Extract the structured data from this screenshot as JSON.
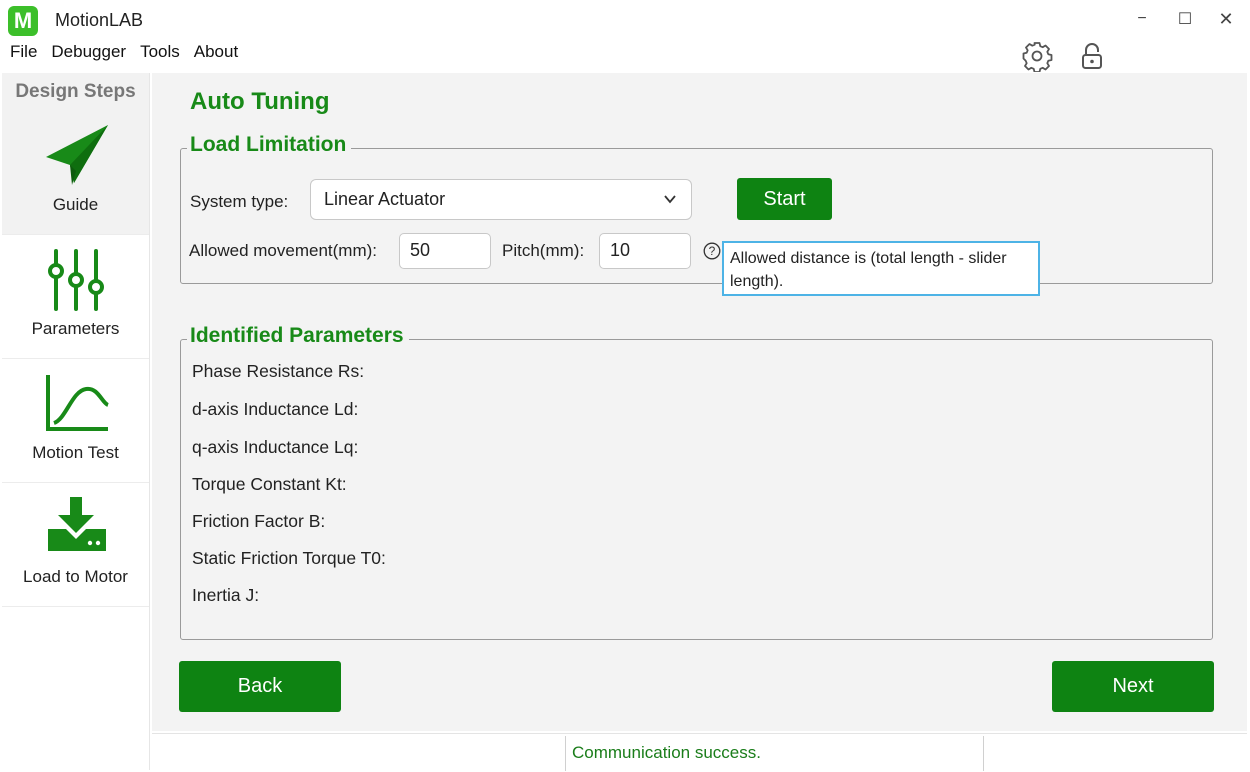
{
  "app": {
    "logo_letter": "M",
    "title": "MotionLAB",
    "logo_color": "#3cbf2a"
  },
  "window_controls": {
    "minimize": "−",
    "maximize": "☐",
    "close": "✕"
  },
  "menu": [
    "File",
    "Debugger",
    "Tools",
    "About"
  ],
  "toolbar_icons": [
    "settings-icon",
    "lock-icon"
  ],
  "sidebar": {
    "header": "Design Steps",
    "steps": [
      {
        "label": "Guide",
        "icon": "paper-plane-icon",
        "active": true
      },
      {
        "label": "Parameters",
        "icon": "sliders-icon",
        "active": false
      },
      {
        "label": "Motion Test",
        "icon": "curve-chart-icon",
        "active": false
      },
      {
        "label": "Load to Motor",
        "icon": "download-to-drive-icon",
        "active": false
      }
    ]
  },
  "main": {
    "title": "Auto Tuning",
    "load_limitation": {
      "title": "Load Limitation",
      "system_type_label": "System type:",
      "system_type_value": "Linear Actuator",
      "start_button": "Start",
      "allowed_movement_label": "Allowed movement(mm):",
      "allowed_movement_value": "50",
      "pitch_label": "Pitch(mm):",
      "pitch_value": "10",
      "help_icon": "?",
      "tooltip": "Allowed distance is (total length - slider length)."
    },
    "identified_parameters": {
      "title": "Identified Parameters",
      "items": [
        "Phase Resistance Rs:",
        "d-axis Inductance Ld:",
        "q-axis Inductance Lq:",
        "Torque Constant Kt:",
        "Friction Factor B:",
        "Static Friction Torque T0:",
        "Inertia J:"
      ]
    },
    "back_button": "Back",
    "next_button": "Next"
  },
  "status": {
    "message": "Communication success."
  },
  "colors": {
    "accent_green": "#188a18",
    "button_green": "#0e8312",
    "tooltip_border": "#4db3e6"
  }
}
